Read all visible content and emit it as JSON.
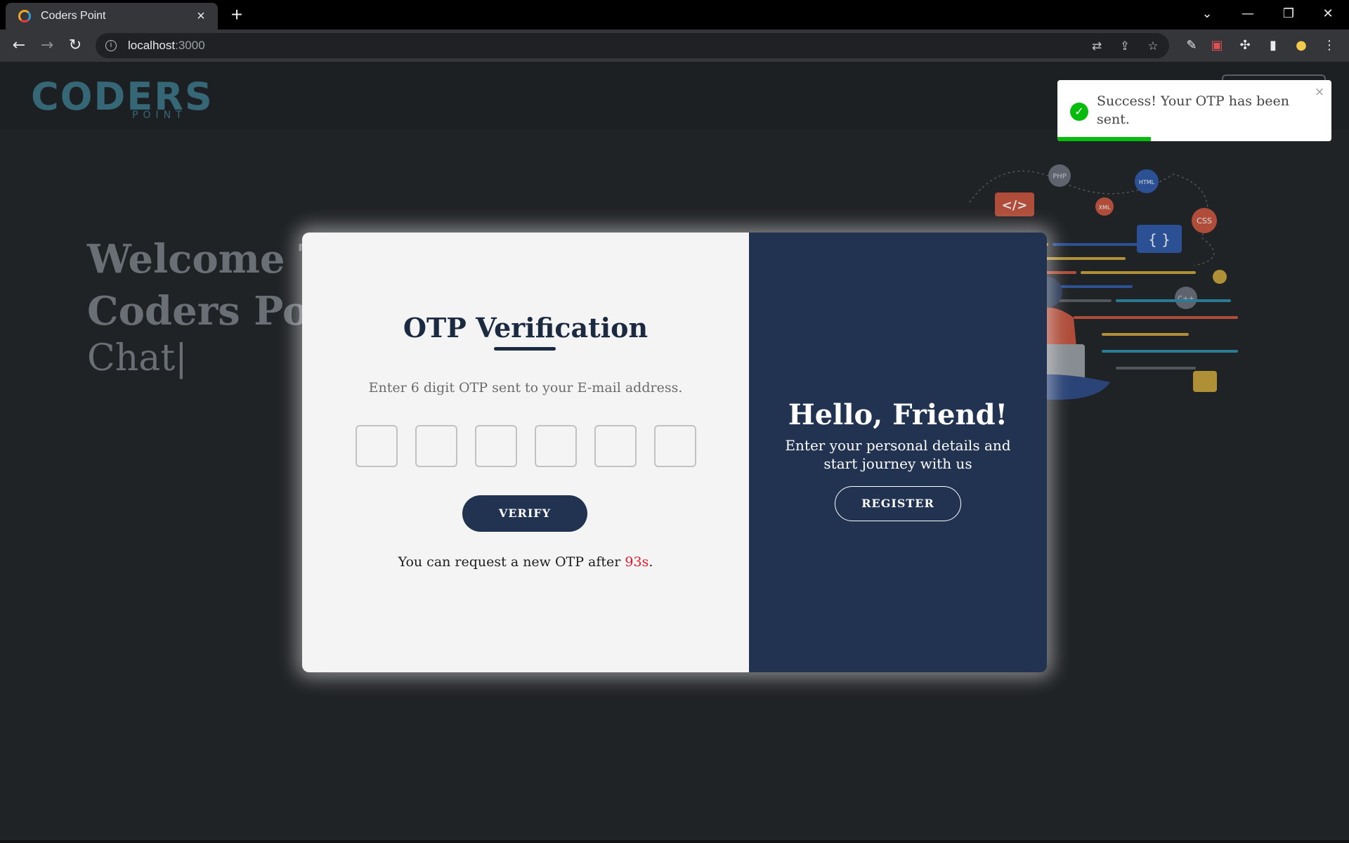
{
  "browser": {
    "tab_title": "Coders Point",
    "tab_close": "×",
    "new_tab": "+",
    "url_host": "localhost",
    "url_port": ":3000",
    "window_controls": {
      "tabsearch": "⌄",
      "minimize": "—",
      "restore": "❐",
      "close": "✕"
    }
  },
  "navbar": {
    "logo_text": "CODERS",
    "logo_sub": "POINT"
  },
  "hero": {
    "line1": "Welcome To",
    "line2": "Coders Point",
    "line3": "Chat|"
  },
  "otp_modal": {
    "title": "OTP Verification",
    "description": "Enter 6 digit OTP sent to your E-mail address.",
    "digits": [
      "",
      "",
      "",
      "",
      "",
      ""
    ],
    "verify_label": "VERIFY",
    "resend_prefix": "You can request a new OTP after ",
    "resend_timer": "93s",
    "resend_suffix": "."
  },
  "side_panel": {
    "heading": "Hello, Friend!",
    "subtext": "Enter your personal details and start journey with us",
    "register_label": "REGISTER"
  },
  "toast": {
    "message": "Success! Your OTP has been sent.",
    "close": "×",
    "progress": 0.34,
    "status_color": "#07bc0c"
  },
  "illustration_tags": {
    "php": "PHP",
    "html": "HTML",
    "xml": "XML",
    "css": "CSS",
    "cpp": "C++",
    "code": "</>",
    "braces": "{ }"
  },
  "colors": {
    "page_bg": "#202326",
    "panel_dark": "#213350",
    "accent_red": "#e0182a"
  }
}
